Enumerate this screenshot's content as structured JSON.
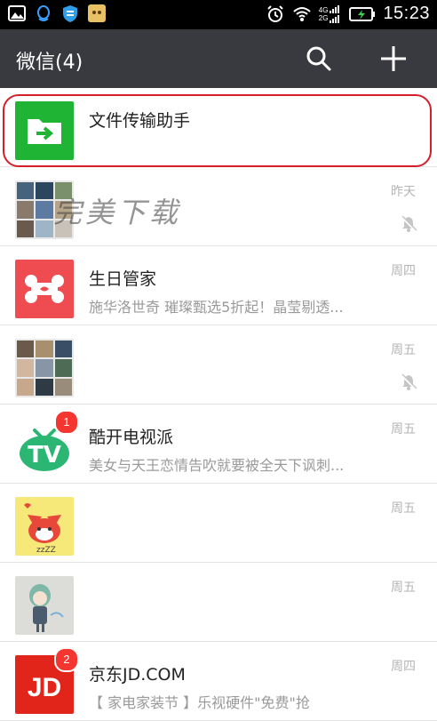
{
  "status_bar": {
    "time": "15:23",
    "network_top": "4G",
    "network_bottom": "2G"
  },
  "header": {
    "title": "微信(4)"
  },
  "watermark": "完美下载",
  "chats": [
    {
      "name": "文件传输助手",
      "message": "",
      "time": "",
      "muted": false,
      "badge": ""
    },
    {
      "name": "",
      "message": "",
      "time": "昨天",
      "muted": true,
      "badge": ""
    },
    {
      "name": "生日管家",
      "message": "施华洛世奇 璀璨甄选5折起！晶莹剔透...",
      "time": "周四",
      "muted": false,
      "badge": ""
    },
    {
      "name": "",
      "message": "",
      "time": "周五",
      "muted": true,
      "badge": ""
    },
    {
      "name": "酷开电视派",
      "message": "美女与天王恋情告吹就要被全天下讽刺...",
      "time": "周五",
      "muted": false,
      "badge": "1"
    },
    {
      "name": "",
      "message": "",
      "time": "周五",
      "muted": false,
      "badge": ""
    },
    {
      "name": "",
      "message": "",
      "time": "周五",
      "muted": false,
      "badge": ""
    },
    {
      "name": "京东JD.COM",
      "message": "【 家电家装节 】乐视硬件\"免费\"抢",
      "time": "周四",
      "muted": false,
      "badge": "2"
    }
  ],
  "avatar_texts": {
    "tv_logo": "TV",
    "jd_logo": "JD",
    "sleep_text": "zzZZ"
  },
  "colors": {
    "titlebar": "#393a3f",
    "file_helper_green": "#20b435",
    "badge_red": "#f43530",
    "highlight_red": "#d41f2b",
    "jd_red": "#e1251b",
    "birthday_red": "#ef4c52"
  }
}
